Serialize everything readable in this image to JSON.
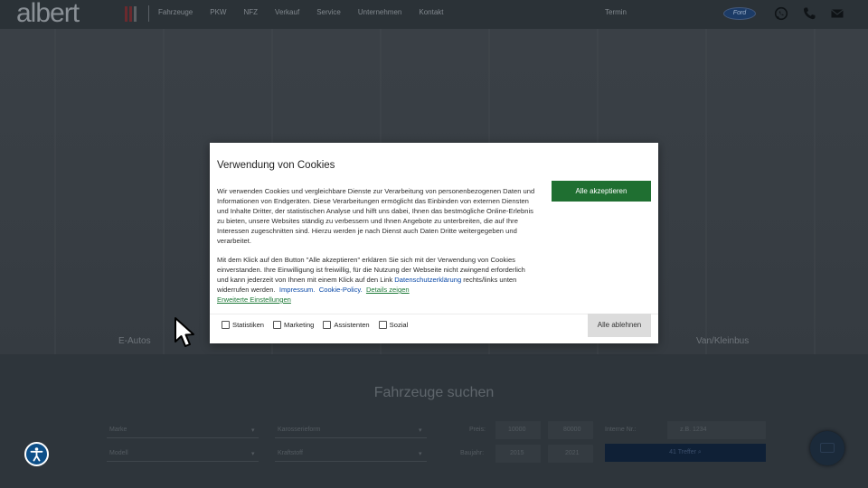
{
  "header": {
    "logo": "albert",
    "nav": [
      "Fahrzeuge",
      "PKW",
      "NFZ",
      "Verkauf",
      "Service",
      "Unternehmen",
      "Kontakt"
    ],
    "termin": "Termin",
    "brand_badge": "Ford",
    "icons": [
      "whatsapp-icon",
      "phone-icon",
      "mail-icon"
    ]
  },
  "categories": {
    "first": "E-Autos",
    "last": "Van/Kleinbus"
  },
  "search": {
    "title": "Fahrzeuge suchen",
    "marke": "Marke",
    "karosserie": "Karosserieform",
    "modell": "Modell",
    "kraftstoff": "Kraftstoff",
    "preis_label": "Preis:",
    "preis_from": "10000",
    "preis_to": "80000",
    "baujahr_label": "Baujahr:",
    "baujahr_from": "2015",
    "baujahr_to": "2021",
    "interne_label": "Interne Nr.:",
    "interne_placeholder": "z.B. 1234",
    "submit": "41 Treffer"
  },
  "cookie": {
    "title": "Verwendung von Cookies",
    "para1": "Wir verwenden Cookies und vergleichbare Dienste zur Verarbeitung von personenbezogenen Daten und Informationen von Endgeräten. Diese Verarbeitungen ermöglicht das Einbinden von externen Diensten und Inhalte Dritter, der statistischen Analyse und hilft uns dabei, Ihnen das bestmögliche Online-Erlebnis zu bieten, unsere Websites ständig zu verbessern und Ihnen Angebote zu unterbreiten, die auf Ihre Interessen zugeschnitten sind. Hierzu werden je nach Dienst auch Daten Dritte weitergegeben und verarbeitet.",
    "para2_start": "Mit dem Klick auf den Button \"Alle akzeptieren\" erklären Sie sich mit der Verwendung von Cookies einverstanden. Ihre Einwilligung ist freiwillig, für die Nutzung der Webseite nicht zwingend erforderlich und kann jederzeit von Ihnen mit einem Klick auf den Link ",
    "privacy_link": "Datenschutzerklärung",
    "para2_end": " rechts/links unten widerrufen werden.",
    "impressum": "Impressum.",
    "cookie_policy": "Cookie-Policy.",
    "details": "Details zeigen",
    "advanced": "Erweiterte Einstellungen",
    "accept": "Alle akzeptieren",
    "reject": "Alle ablehnen",
    "checkboxes": [
      "Statistiken",
      "Marketing",
      "Assistenten",
      "Sozial"
    ]
  }
}
